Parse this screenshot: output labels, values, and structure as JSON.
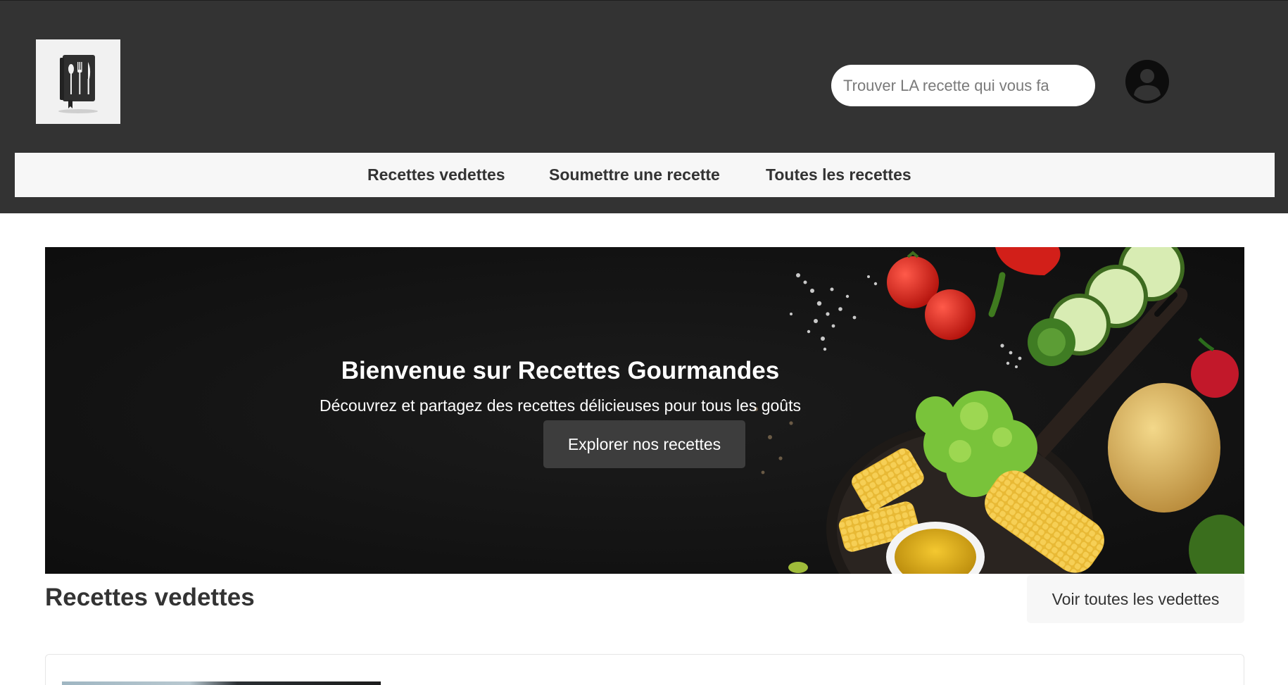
{
  "header": {
    "logo_alt": "Recipe book logo",
    "search": {
      "placeholder": "Trouver LA recette qui vous fa",
      "value": ""
    },
    "account_icon": "account-circle-icon"
  },
  "nav": {
    "items": [
      {
        "label": "Recettes vedettes"
      },
      {
        "label": "Soumettre une recette"
      },
      {
        "label": "Toutes les recettes"
      }
    ]
  },
  "hero": {
    "title": "Bienvenue sur Recettes Gourmandes",
    "subtitle": "Découvrez et partagez des recettes délicieuses pour tous les goûts",
    "cta_label": "Explorer nos recettes"
  },
  "featured": {
    "title": "Recettes vedettes",
    "see_all_label": "Voir toutes les vedettes"
  },
  "colors": {
    "header_bg": "#333333",
    "nav_bg": "#f7f7f7",
    "hero_bg": "#121212",
    "button_dark": "#3d3d3d",
    "button_light": "#f7f7f7"
  }
}
